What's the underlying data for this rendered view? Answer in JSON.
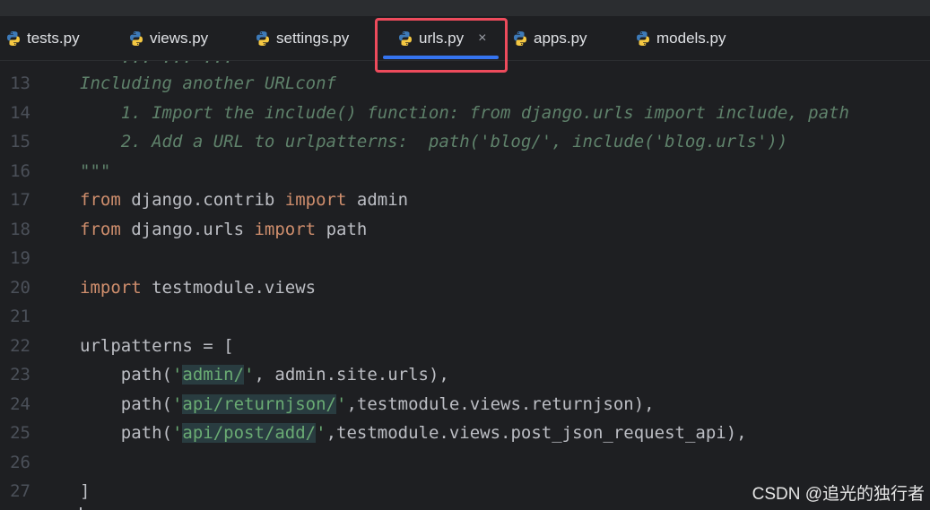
{
  "tabs": [
    {
      "name": "tests.py",
      "icon": "python-icon",
      "active": false
    },
    {
      "name": "views.py",
      "icon": "python-icon",
      "active": false
    },
    {
      "name": "settings.py",
      "icon": "python-icon",
      "active": false
    },
    {
      "name": "urls.py",
      "icon": "python-icon",
      "active": true,
      "close": "×"
    },
    {
      "name": "apps.py",
      "icon": "python-icon",
      "active": false
    },
    {
      "name": "models.py",
      "icon": "python-icon",
      "active": false
    }
  ],
  "colors": {
    "background": "#1e1f22",
    "accent": "#3574f0",
    "highlight_box": "#ee4b5c",
    "keyword": "#cf8e6d",
    "string": "#6aab73",
    "docstring": "#5f826b"
  },
  "editor": {
    "partial_line": "    ... ... ...",
    "lines": [
      {
        "num": "13",
        "segments": [
          {
            "t": "Including another URLconf",
            "c": "doc"
          }
        ]
      },
      {
        "num": "14",
        "segments": [
          {
            "t": "    1. Import the include() function: from django.urls import include, path",
            "c": "doc"
          }
        ]
      },
      {
        "num": "15",
        "segments": [
          {
            "t": "    2. Add a URL to urlpatterns:  path('blog/', include('blog.urls'))",
            "c": "doc"
          }
        ]
      },
      {
        "num": "16",
        "segments": [
          {
            "t": "\"\"\"",
            "c": "doc"
          }
        ]
      },
      {
        "num": "17",
        "segments": [
          {
            "t": "from",
            "c": "kw"
          },
          {
            "t": " django.contrib ",
            "c": ""
          },
          {
            "t": "import",
            "c": "kw"
          },
          {
            "t": " admin",
            "c": ""
          }
        ]
      },
      {
        "num": "18",
        "segments": [
          {
            "t": "from",
            "c": "kw"
          },
          {
            "t": " django.urls ",
            "c": ""
          },
          {
            "t": "import",
            "c": "kw"
          },
          {
            "t": " path",
            "c": ""
          }
        ]
      },
      {
        "num": "19",
        "segments": []
      },
      {
        "num": "20",
        "segments": [
          {
            "t": "import",
            "c": "kw"
          },
          {
            "t": " testmodule.views",
            "c": ""
          }
        ]
      },
      {
        "num": "21",
        "segments": []
      },
      {
        "num": "22",
        "segments": [
          {
            "t": "urlpatterns = [",
            "c": ""
          }
        ]
      },
      {
        "num": "23",
        "segments": [
          {
            "t": "    path(",
            "c": ""
          },
          {
            "t": "'",
            "c": "str"
          },
          {
            "t": "admin/",
            "c": "str strhl"
          },
          {
            "t": "'",
            "c": "str"
          },
          {
            "t": ", admin.site.urls),",
            "c": ""
          }
        ]
      },
      {
        "num": "24",
        "segments": [
          {
            "t": "    path(",
            "c": ""
          },
          {
            "t": "'",
            "c": "str"
          },
          {
            "t": "api/returnjson/",
            "c": "str strhl"
          },
          {
            "t": "'",
            "c": "str"
          },
          {
            "t": ",testmodule.views.returnjson),",
            "c": ""
          }
        ]
      },
      {
        "num": "25",
        "segments": [
          {
            "t": "    path(",
            "c": ""
          },
          {
            "t": "'",
            "c": "str"
          },
          {
            "t": "api/post/add/",
            "c": "str strhl"
          },
          {
            "t": "'",
            "c": "str"
          },
          {
            "t": ",testmodule.views.post_json_request_api),",
            "c": ""
          }
        ]
      },
      {
        "num": "26",
        "segments": []
      },
      {
        "num": "27",
        "segments": [
          {
            "t": "]",
            "c": ""
          }
        ]
      }
    ]
  },
  "watermark": "CSDN @追光的独行者"
}
